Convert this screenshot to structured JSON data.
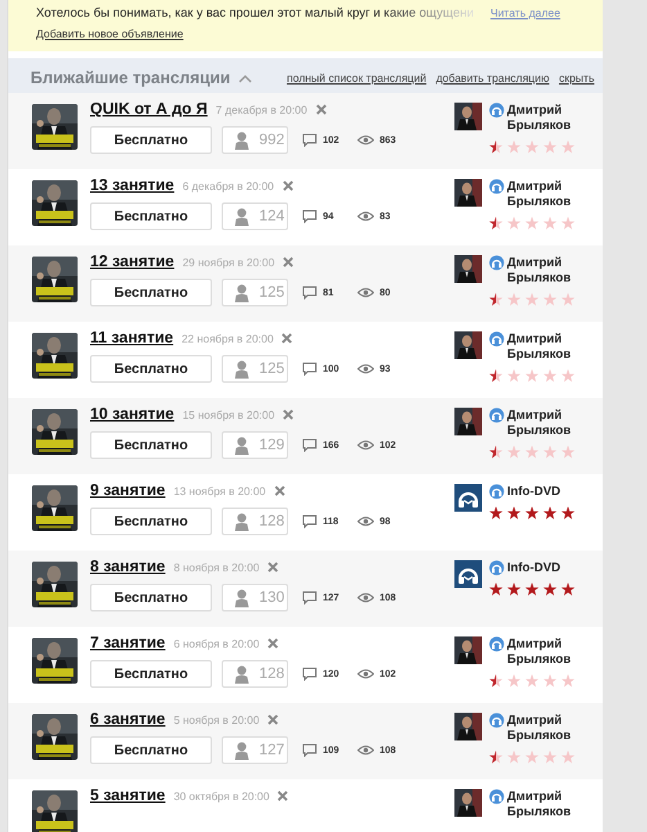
{
  "notice": {
    "text": "Хотелось бы понимать, как у вас прошел этот малый круг и какие ощущени",
    "read_more": "Читать далее",
    "add_link": "Добавить новое объявление"
  },
  "section": {
    "title": "Ближайшие трансляции",
    "expanded": true,
    "links": [
      "полный список трансляций",
      "добавить трансляцию",
      "скрыть"
    ]
  },
  "broadcasts": [
    {
      "title": "QUIK от А до Я",
      "date": "7 декабря в 20:00",
      "price": "Бесплатно",
      "participants": "992",
      "comments": "102",
      "views": "863",
      "author": {
        "name": "Дмитрий Брыляков",
        "kind": "person",
        "stars": 0.5
      }
    },
    {
      "title": "13 занятие",
      "date": "6 декабря в 20:00",
      "price": "Бесплатно",
      "participants": "124",
      "comments": "94",
      "views": "83",
      "author": {
        "name": "Дмитрий Брыляков",
        "kind": "person",
        "stars": 0.5
      }
    },
    {
      "title": "12 занятие",
      "date": "29 ноября в 20:00",
      "price": "Бесплатно",
      "participants": "125",
      "comments": "81",
      "views": "80",
      "author": {
        "name": "Дмитрий Брыляков",
        "kind": "person",
        "stars": 0.5
      }
    },
    {
      "title": "11 занятие",
      "date": "22 ноября в 20:00",
      "price": "Бесплатно",
      "participants": "125",
      "comments": "100",
      "views": "93",
      "author": {
        "name": "Дмитрий Брыляков",
        "kind": "person",
        "stars": 0.5
      }
    },
    {
      "title": "10 занятие",
      "date": "15 ноября в 20:00",
      "price": "Бесплатно",
      "participants": "129",
      "comments": "166",
      "views": "102",
      "author": {
        "name": "Дмитрий Брыляков",
        "kind": "person",
        "stars": 0.5
      }
    },
    {
      "title": "9 занятие",
      "date": "13 ноября в 20:00",
      "price": "Бесплатно",
      "participants": "128",
      "comments": "118",
      "views": "98",
      "author": {
        "name": "Info-DVD",
        "kind": "logo",
        "stars": 5
      }
    },
    {
      "title": "8 занятие",
      "date": "8 ноября в 20:00",
      "price": "Бесплатно",
      "participants": "130",
      "comments": "127",
      "views": "108",
      "author": {
        "name": "Info-DVD",
        "kind": "logo",
        "stars": 5
      }
    },
    {
      "title": "7 занятие",
      "date": "6 ноября в 20:00",
      "price": "Бесплатно",
      "participants": "128",
      "comments": "120",
      "views": "102",
      "author": {
        "name": "Дмитрий Брыляков",
        "kind": "person",
        "stars": 0.5
      }
    },
    {
      "title": "6 занятие",
      "date": "5 ноября в 20:00",
      "price": "Бесплатно",
      "participants": "127",
      "comments": "109",
      "views": "108",
      "author": {
        "name": "Дмитрий Брыляков",
        "kind": "person",
        "stars": 0.5
      }
    },
    {
      "title": "5 занятие",
      "date": "30 октября в 20:00",
      "author": {
        "name": "Дмитрий Брыляков",
        "kind": "person"
      }
    }
  ]
}
